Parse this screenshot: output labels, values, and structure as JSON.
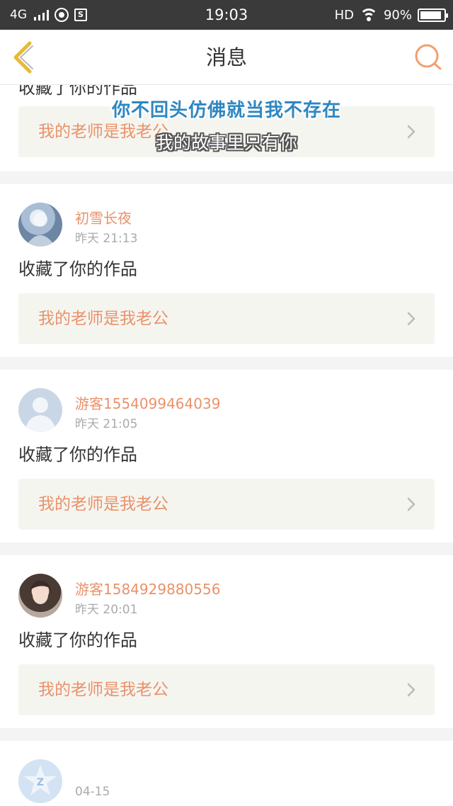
{
  "status_bar": {
    "network": "4G",
    "time": "19:03",
    "hd": "HD",
    "battery": "90%",
    "battery_level": 0.9
  },
  "nav": {
    "title": "消息",
    "back_icon": "chevron-left-icon",
    "search_icon": "search-icon"
  },
  "overlay": {
    "line1": "你不回头仿佛就当我不存在",
    "line2": "我的故事里只有你"
  },
  "partial_card": {
    "action": "收藏了你的作品",
    "work_title": "我的老师是我老公"
  },
  "cards": [
    {
      "name": "初雪长夜",
      "time": "昨天 21:13",
      "action": "收藏了你的作品",
      "work_title": "我的老师是我老公"
    },
    {
      "name": "游客1554099464039",
      "time": "昨天 21:05",
      "action": "收藏了你的作品",
      "work_title": "我的老师是我老公"
    },
    {
      "name": "游客1584929880556",
      "time": "昨天 20:01",
      "action": "收藏了你的作品",
      "work_title": "我的老师是我老公"
    }
  ],
  "last_card": {
    "name": "",
    "time": "04-15"
  },
  "colors": {
    "accent": "#e9926a",
    "back_icon": "#e8b93a"
  }
}
